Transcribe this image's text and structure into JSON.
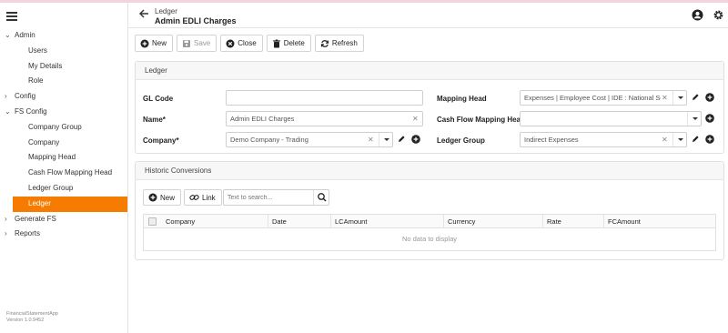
{
  "sidebar": {
    "items": [
      {
        "label": "Admin",
        "chevron": "⌄"
      },
      {
        "label": "Users"
      },
      {
        "label": "My Details"
      },
      {
        "label": "Role"
      },
      {
        "label": "Config",
        "chevron": "›"
      },
      {
        "label": "FS Config",
        "chevron": "⌄"
      },
      {
        "label": "Company Group"
      },
      {
        "label": "Company"
      },
      {
        "label": "Mapping Head"
      },
      {
        "label": "Cash Flow Mapping Head"
      },
      {
        "label": "Ledger Group"
      },
      {
        "label": "Ledger"
      },
      {
        "label": "Generate FS",
        "chevron": "›"
      },
      {
        "label": "Reports",
        "chevron": "›"
      }
    ],
    "app_name": "FinancialStatementApp",
    "version": "Version 1.0.9452"
  },
  "header": {
    "breadcrumb": "Ledger",
    "title": "Admin EDLI Charges",
    "icons": [
      "account-circle-icon",
      "gear-icon"
    ]
  },
  "toolbar": {
    "new_label": "New",
    "save_label": "Save",
    "close_label": "Close",
    "delete_label": "Delete",
    "refresh_label": "Refresh"
  },
  "ledger_panel": {
    "title": "Ledger",
    "gl_code_label": "GL Code",
    "gl_code_value": "",
    "name_label": "Name*",
    "name_value": "Admin EDLI Charges",
    "company_label": "Company*",
    "company_value": "Demo Company - Trading",
    "mapping_head_label": "Mapping Head",
    "mapping_head_value": "Expenses | Employee Cost | IDE : National So...",
    "cash_flow_label": "Cash Flow Mapping Head",
    "cash_flow_value": "",
    "ledger_group_label": "Ledger Group",
    "ledger_group_value": "Indirect Expenses"
  },
  "history_panel": {
    "title": "Historic Conversions",
    "new_label": "New",
    "link_label": "Link",
    "search_placeholder": "Text to search...",
    "columns": [
      "Company",
      "Date",
      "LCAmount",
      "Currency",
      "Rate",
      "FCAmount"
    ],
    "empty_text": "No data to display"
  },
  "colors": {
    "accent": "#f57c00",
    "topline": "#f3d3dc"
  }
}
